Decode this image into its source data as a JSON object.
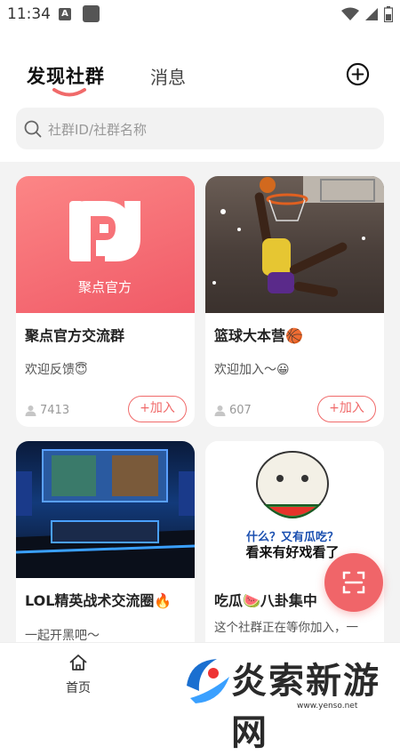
{
  "status_bar": {
    "time": "11:34",
    "a_glyph": "A"
  },
  "header": {
    "tab_discover": "发现社群",
    "tab_messages": "消息",
    "add_icon": "plus-circle-icon"
  },
  "search": {
    "placeholder": "社群ID/社群名称"
  },
  "cards": [
    {
      "name": "聚点官方交流群",
      "desc": "欢迎反馈😇",
      "members": "7413",
      "join": "+加入",
      "logo_text": "聚点官方"
    },
    {
      "name": "篮球大本营🏀",
      "desc": "欢迎加入～😀",
      "members": "607",
      "join": "+加入"
    },
    {
      "name": "LOL精英战术交流圈🔥",
      "desc": "一起开黑吧～"
    },
    {
      "name": "吃瓜🍉八卦集中",
      "desc": "这个社群正在等你加入，一",
      "meme_text_1": "什么？又有瓜吃？",
      "meme_text_2": "看来有好戏看了"
    }
  ],
  "bottom_nav": {
    "home_label": "首页"
  },
  "watermark": {
    "text": "炎索新游网",
    "url": "www.yenso.net"
  },
  "colors": {
    "accent": "#f06a6a",
    "fab": "#f06569",
    "feed_bg": "#f3f3f3"
  }
}
